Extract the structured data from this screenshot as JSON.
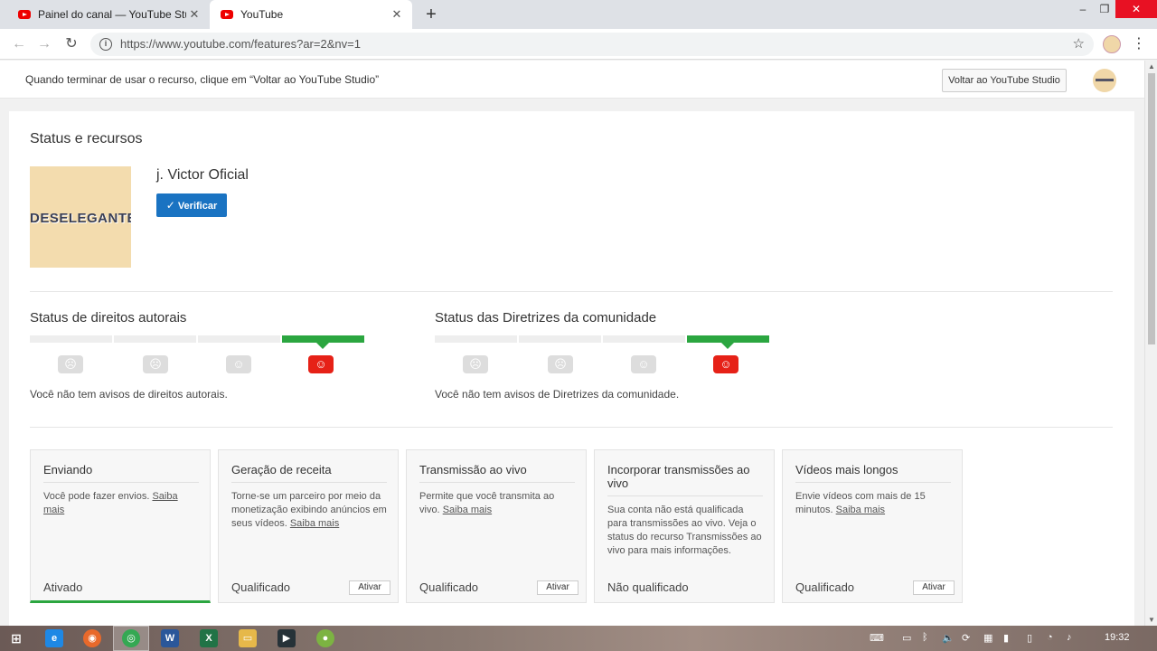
{
  "browser": {
    "tabs": [
      {
        "title": "Painel do canal — YouTube Studio"
      },
      {
        "title": "YouTube"
      }
    ],
    "new_tab": "+",
    "url": "https://www.youtube.com/features?ar=2&nv=1",
    "window_controls": {
      "minimize": "–",
      "maximize": "❐",
      "close": "✕"
    }
  },
  "notice": {
    "text": "Quando terminar de usar o recurso, clique em “Voltar ao YouTube Studio”",
    "button": "Voltar ao YouTube Studio"
  },
  "main": {
    "section_title": "Status e recursos",
    "channel": {
      "thumbnail_text": "DESELEGANTE",
      "name": "j. Victor Oficial",
      "verify_label": "Verificar"
    },
    "copyright": {
      "title": "Status de direitos autorais",
      "description": "Você não tem avisos de direitos autorais."
    },
    "community": {
      "title": "Status das Diretrizes da comunidade",
      "description": "Você não tem avisos de Diretrizes da comunidade."
    },
    "features": [
      {
        "title": "Enviando",
        "description": "Você pode fazer envios. ",
        "link": "Saiba mais",
        "status": "Ativado",
        "button": ""
      },
      {
        "title": "Geração de receita",
        "description": "Torne-se um parceiro por meio da monetização exibindo anúncios em seus vídeos. ",
        "link": "Saiba mais",
        "status": "Qualificado",
        "button": "Ativar"
      },
      {
        "title": "Transmissão ao vivo",
        "description": "Permite que você transmita ao vivo. ",
        "link": "Saiba mais",
        "status": "Qualificado",
        "button": "Ativar"
      },
      {
        "title": "Incorporar transmissões ao vivo",
        "description": "Sua conta não está qualificada para transmissões ao vivo. Veja o status do recurso Transmissões ao vivo para mais informações.",
        "link": "",
        "status": "Não qualificado",
        "button": ""
      },
      {
        "title": "Vídeos mais longos",
        "description": "Envie vídeos com mais de 15 minutos. ",
        "link": "Saiba mais",
        "status": "Qualificado",
        "button": "Ativar"
      }
    ]
  },
  "taskbar": {
    "clock": "19:32"
  },
  "colors": {
    "accent_blue": "#1a73c2",
    "green": "#2ba640",
    "red": "#e62117"
  }
}
